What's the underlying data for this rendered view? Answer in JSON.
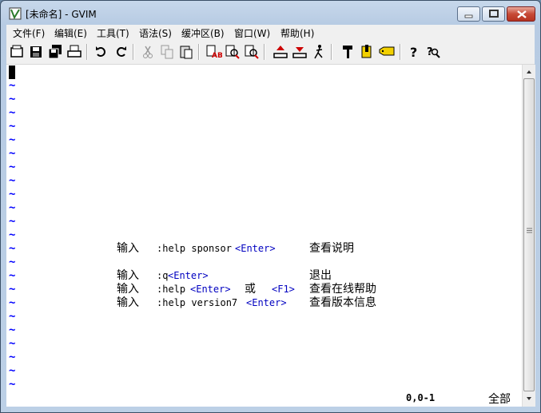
{
  "window": {
    "title": "[未命名] - GVIM"
  },
  "menu": [
    {
      "label": "文件(F)"
    },
    {
      "label": "编辑(E)"
    },
    {
      "label": "工具(T)"
    },
    {
      "label": "语法(S)"
    },
    {
      "label": "缓冲区(B)"
    },
    {
      "label": "窗口(W)"
    },
    {
      "label": "帮助(H)"
    }
  ],
  "toolbar": [
    "open-icon",
    "save-icon",
    "save-all-icon",
    "print-icon",
    "undo-icon",
    "redo-icon",
    "cut-icon",
    "copy-icon",
    "paste-icon",
    "find-replace-icon",
    "find-next-icon",
    "find-prev-icon",
    "load-session-icon",
    "save-session-icon",
    "run-script-icon",
    "make-icon",
    "run-ctags-icon",
    "jump-tag-icon",
    "help-icon",
    "find-help-icon"
  ],
  "intro": {
    "l1": {
      "a": "输入",
      "b": ":help sponsor",
      "c": "<Enter>",
      "d": "查看说明"
    },
    "l2": {
      "a": "输入",
      "b": ":q",
      "c": "<Enter>",
      "d": "退出"
    },
    "l3": {
      "a": "输入",
      "b": ":help",
      "c": "<Enter>",
      "e": "或",
      "f": "<F1>",
      "d": "查看在线帮助"
    },
    "l4": {
      "a": "输入",
      "b": ":help version7",
      "c": "<Enter>",
      "d": "查看版本信息"
    }
  },
  "status": {
    "position": "0,0-1",
    "scroll": "全部"
  },
  "colors": {
    "tilde": "#0000ff",
    "special_key": "#0000c0",
    "close_button": "#c74a36"
  }
}
